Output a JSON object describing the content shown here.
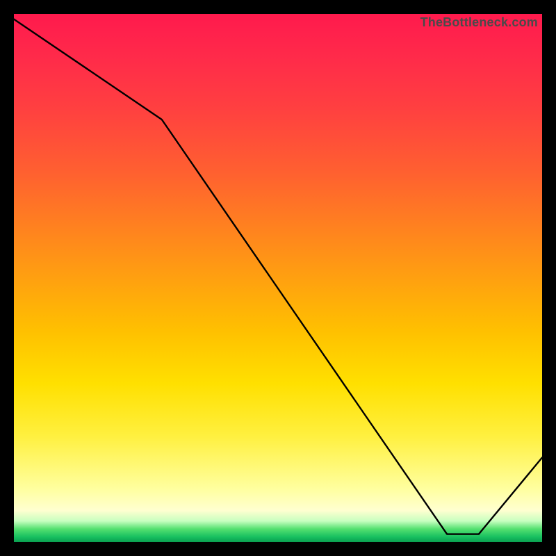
{
  "watermark": "TheBottleneck.com",
  "red_label": "",
  "chart_data": {
    "type": "line",
    "title": "",
    "xlabel": "",
    "ylabel": "",
    "xlim": [
      0,
      100
    ],
    "ylim": [
      0,
      100
    ],
    "grid": false,
    "legend": false,
    "series": [
      {
        "name": "curve",
        "x": [
          0,
          28,
          82,
          88,
          100
        ],
        "y": [
          99,
          80,
          1.5,
          1.5,
          16
        ]
      }
    ],
    "note": "y values are approximate visual readings on a 0–100 scale; the plateau near y≈1.5 sits on the green band at the bottom."
  }
}
